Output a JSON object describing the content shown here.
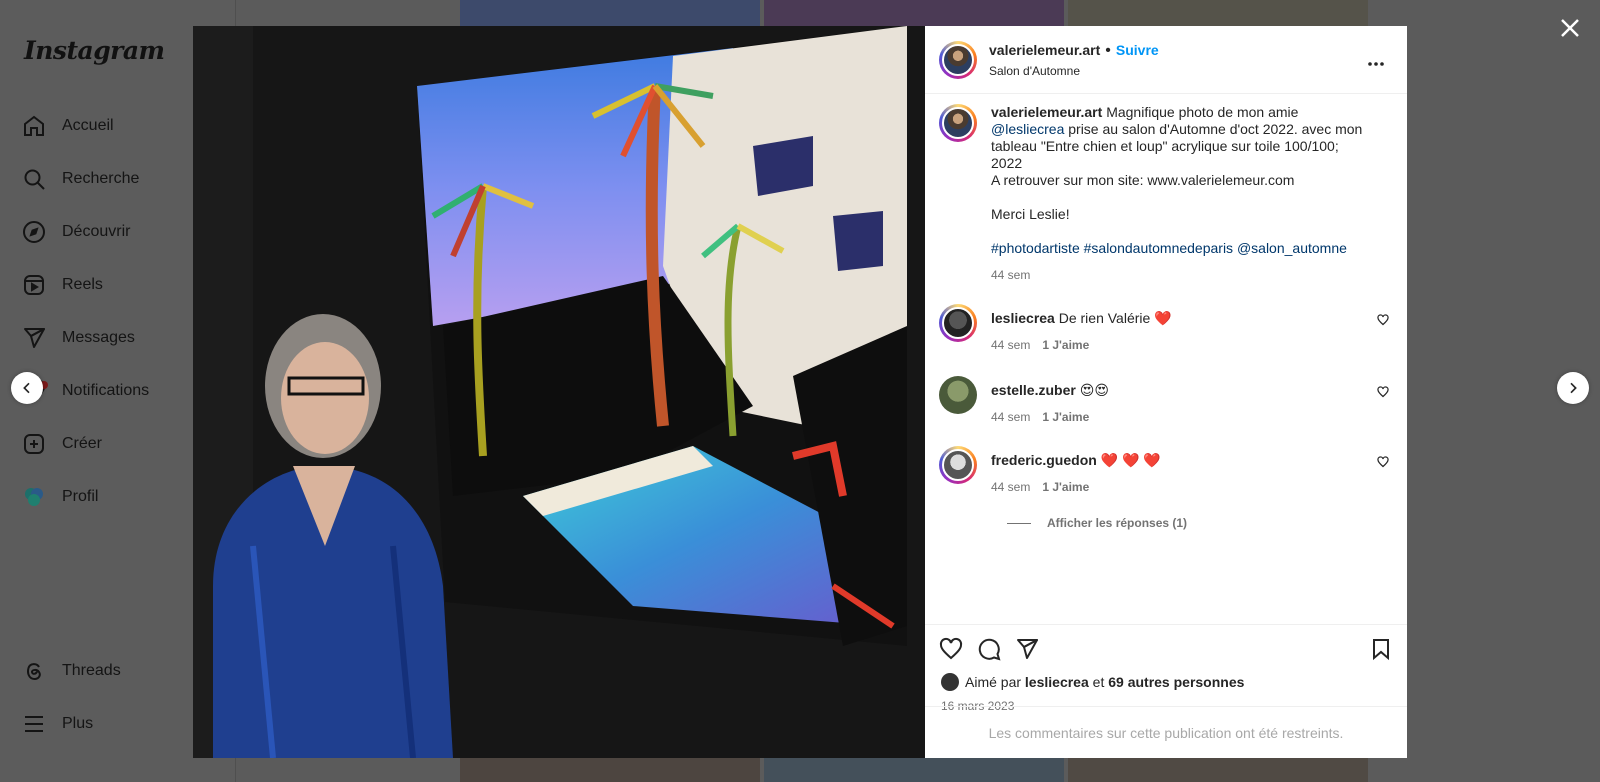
{
  "app": {
    "logo": "Instagram"
  },
  "sidebar": {
    "items": [
      {
        "label": "Accueil",
        "icon": "home-icon"
      },
      {
        "label": "Recherche",
        "icon": "search-icon"
      },
      {
        "label": "Découvrir",
        "icon": "compass-icon"
      },
      {
        "label": "Reels",
        "icon": "reels-icon"
      },
      {
        "label": "Messages",
        "icon": "send-icon"
      },
      {
        "label": "Notifications",
        "icon": "heart-icon"
      },
      {
        "label": "Créer",
        "icon": "plus-square-icon"
      },
      {
        "label": "Profil",
        "icon": "avatar"
      }
    ],
    "bottom": [
      {
        "label": "Threads",
        "icon": "threads-icon"
      },
      {
        "label": "Plus",
        "icon": "menu-icon"
      }
    ]
  },
  "post": {
    "author": "valerielemeur.art",
    "separator": "•",
    "follow_label": "Suivre",
    "location": "Salon d'Automne",
    "caption": {
      "user": "valerielemeur.art",
      "text1": "Magnifique photo de mon amie",
      "mention": "@lesliecrea",
      "text2": "prise au salon d'Automne d'oct 2022. avec mon tableau \"Entre chien et loup\" acrylique sur toile 100/100; 2022",
      "text3": "A retrouver sur mon site: www.valerielemeur.com",
      "text4": "Merci Leslie!",
      "tags": "#photodartiste #salondautomnedeparis @salon_automne",
      "time": "44 sem"
    },
    "comments": [
      {
        "user": "lesliecrea",
        "text": "De rien Valérie ❤️",
        "time": "44 sem",
        "likes": "1 J'aime"
      },
      {
        "user": "estelle.zuber",
        "text": "😍😍",
        "time": "44 sem",
        "likes": "1 J'aime"
      },
      {
        "user": "frederic.guedon",
        "text": "❤️ ❤️ ❤️",
        "time": "44 sem",
        "likes": "1 J'aime"
      }
    ],
    "replies_label": "Afficher les réponses (1)",
    "liked_by_prefix": "Aimé par",
    "liked_by_user": "lesliecrea",
    "liked_by_and": "et",
    "liked_by_others": "69 autres personnes",
    "date": "16 mars 2023",
    "restricted": "Les commentaires sur cette publication ont été restreints."
  },
  "colors": {
    "accent": "#0095f6",
    "link": "#00376b",
    "muted": "#737373"
  }
}
